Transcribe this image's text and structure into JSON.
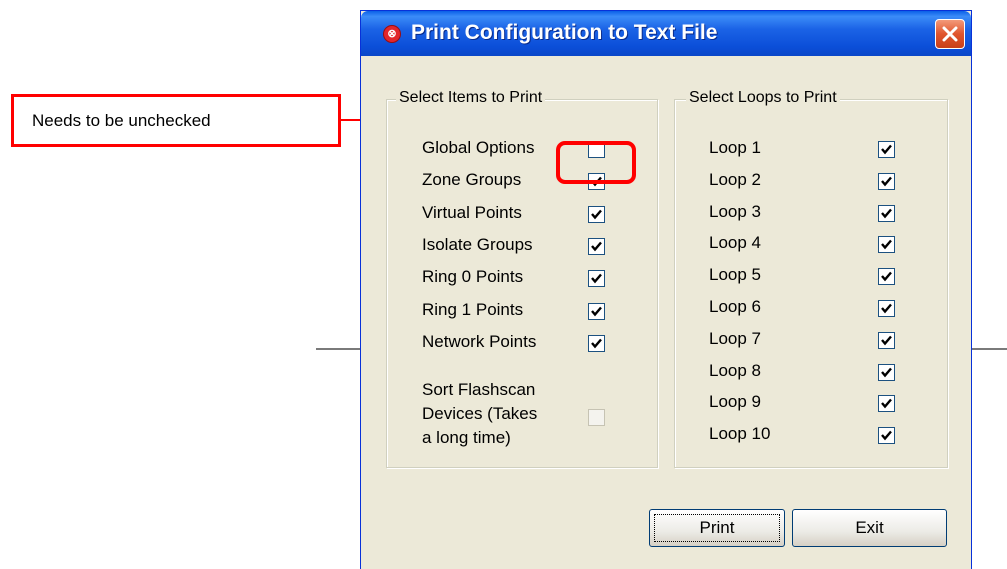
{
  "callout": {
    "text": "Needs to be unchecked",
    "color": "#ff0000"
  },
  "dialog": {
    "title": "Print Configuration to Text File",
    "app_icon": "app-icon",
    "close_icon": "close-icon",
    "titlebar_color": "#0a4fd9",
    "items_group": {
      "legend": "Select Items to Print",
      "items": [
        {
          "label": "Global Options",
          "checked": false
        },
        {
          "label": "Zone Groups",
          "checked": true
        },
        {
          "label": "Virtual Points",
          "checked": true
        },
        {
          "label": "Isolate Groups",
          "checked": true
        },
        {
          "label": "Ring 0 Points",
          "checked": true
        },
        {
          "label": "Ring 1 Points",
          "checked": true
        },
        {
          "label": "Network Points",
          "checked": true
        }
      ],
      "sort_option": {
        "lines": [
          "Sort Flashscan",
          "Devices (Takes",
          "a long time)"
        ],
        "checked": false,
        "enabled": false
      }
    },
    "loops_group": {
      "legend": "Select Loops to Print",
      "loops": [
        {
          "label": "Loop 1",
          "checked": true
        },
        {
          "label": "Loop 2",
          "checked": true
        },
        {
          "label": "Loop 3",
          "checked": true
        },
        {
          "label": "Loop 4",
          "checked": true
        },
        {
          "label": "Loop 5",
          "checked": true
        },
        {
          "label": "Loop 6",
          "checked": true
        },
        {
          "label": "Loop 7",
          "checked": true
        },
        {
          "label": "Loop 8",
          "checked": true
        },
        {
          "label": "Loop 9",
          "checked": true
        },
        {
          "label": "Loop 10",
          "checked": true
        }
      ]
    },
    "buttons": {
      "print": "Print",
      "exit": "Exit"
    }
  }
}
